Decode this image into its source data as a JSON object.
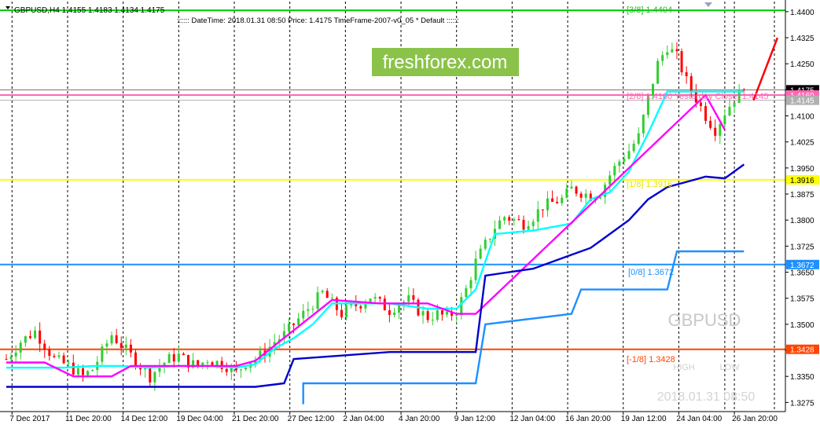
{
  "header": {
    "symbol_info": "GBPUSD,H4  1.4155 1.4183 1.4134 1.4175",
    "info_line": ":::::: DateTime: 2018.01.31 08:50    Price: 1.4175    TimeFrame-2007-v0_05    *    Default    ::::::"
  },
  "watermark": {
    "brand": "freshforex.com",
    "symbol": "GBPUSD",
    "datetime": "2018.01.31 08:50",
    "high_label": "HIGH",
    "low_label": "LOW"
  },
  "murrey_labels": [
    {
      "id": "p3",
      "text": "[3/8]  1.4404"
    },
    {
      "id": "p2",
      "text": "[2/8]  1.4160  Yesterday Close: 1.4145"
    },
    {
      "id": "p1",
      "text": "[1/8]  1.3916"
    },
    {
      "id": "p0",
      "text": "[0/8]  1.3672"
    },
    {
      "id": "m1",
      "text": "[-1/8]  1.3428"
    }
  ],
  "price_axis": {
    "ticks": [
      "1.4400",
      "1.4325",
      "1.4250",
      "1.4175",
      "1.4100",
      "1.4025",
      "1.3950",
      "1.3875",
      "1.3800",
      "1.3725",
      "1.3650",
      "1.3575",
      "1.3500",
      "1.3425",
      "1.3350",
      "1.3275"
    ],
    "tags": [
      {
        "id": "last",
        "text": "1.4175",
        "value": 1.4175,
        "color": "#000000",
        "text_color": "#ffffff"
      },
      {
        "id": "l2",
        "text": "1.4160",
        "value": 1.416,
        "color": "#ff69b4",
        "text_color": "#ffffff"
      },
      {
        "id": "yc",
        "text": "1.4145",
        "value": 1.4145,
        "color": "#b0b0b0",
        "text_color": "#ffffff"
      },
      {
        "id": "l1",
        "text": "1.3916",
        "value": 1.3916,
        "color": "#ffff00",
        "text_color": "#000000"
      },
      {
        "id": "l0",
        "text": "1.3672",
        "value": 1.3672,
        "color": "#1e90ff",
        "text_color": "#ffffff"
      },
      {
        "id": "lm1",
        "text": "1.3428",
        "value": 1.3428,
        "color": "#ff4500",
        "text_color": "#ffffff"
      }
    ]
  },
  "time_axis": {
    "labels": [
      "7 Dec 2017",
      "11 Dec 20:00",
      "14 Dec 12:00",
      "19 Dec 04:00",
      "21 Dec 20:00",
      "27 Dec 12:00",
      "2 Jan 04:00",
      "4 Jan 20:00",
      "9 Jan 12:00",
      "12 Jan 04:00",
      "16 Jan 20:00",
      "19 Jan 12:00",
      "24 Jan 04:00",
      "26 Jan 20:00"
    ]
  },
  "chart_data": {
    "type": "candlestick",
    "symbol": "GBPUSD",
    "timeframe": "H4",
    "ylim": [
      1.326,
      1.442
    ],
    "grid": true,
    "ohlc_current": {
      "open": 1.4155,
      "high": 1.4183,
      "low": 1.4134,
      "close": 1.4175
    },
    "horizontal_levels": [
      {
        "name": "[3/8]",
        "value": 1.4404,
        "color": "#00cc00"
      },
      {
        "name": "[2/8]",
        "value": 1.416,
        "color": "#ff69b4"
      },
      {
        "name": "Yesterday Close",
        "value": 1.4145,
        "color": "#b0b0b0"
      },
      {
        "name": "[1/8]",
        "value": 1.3916,
        "color": "#ffff00"
      },
      {
        "name": "[0/8]",
        "value": 1.3672,
        "color": "#1e90ff"
      },
      {
        "name": "[-1/8]",
        "value": 1.3428,
        "color": "#ff4500"
      }
    ],
    "close_path": [
      [
        0,
        1.34
      ],
      [
        3,
        1.345
      ],
      [
        6,
        1.348
      ],
      [
        8,
        1.344
      ],
      [
        10,
        1.34
      ],
      [
        13,
        1.338
      ],
      [
        16,
        1.335
      ],
      [
        18,
        1.337
      ],
      [
        20,
        1.342
      ],
      [
        22,
        1.347
      ],
      [
        24,
        1.344
      ],
      [
        26,
        1.341
      ],
      [
        28,
        1.338
      ],
      [
        30,
        1.335
      ],
      [
        32,
        1.338
      ],
      [
        34,
        1.34
      ],
      [
        36,
        1.341
      ],
      [
        38,
        1.339
      ],
      [
        40,
        1.338
      ],
      [
        42,
        1.34
      ],
      [
        44,
        1.339
      ],
      [
        46,
        1.338
      ],
      [
        48,
        1.336
      ],
      [
        50,
        1.339
      ],
      [
        52,
        1.34
      ],
      [
        54,
        1.342
      ],
      [
        56,
        1.345
      ],
      [
        58,
        1.347
      ],
      [
        60,
        1.35
      ],
      [
        62,
        1.353
      ],
      [
        64,
        1.356
      ],
      [
        66,
        1.359
      ],
      [
        68,
        1.356
      ],
      [
        70,
        1.353
      ],
      [
        72,
        1.355
      ],
      [
        74,
        1.356
      ],
      [
        76,
        1.358
      ],
      [
        78,
        1.356
      ],
      [
        80,
        1.354
      ],
      [
        82,
        1.356
      ],
      [
        84,
        1.357
      ],
      [
        86,
        1.354
      ],
      [
        88,
        1.352
      ],
      [
        90,
        1.353
      ],
      [
        92,
        1.352
      ],
      [
        94,
        1.354
      ],
      [
        96,
        1.36
      ],
      [
        98,
        1.368
      ],
      [
        100,
        1.373
      ],
      [
        102,
        1.378
      ],
      [
        104,
        1.381
      ],
      [
        106,
        1.38
      ],
      [
        108,
        1.379
      ],
      [
        110,
        1.381
      ],
      [
        112,
        1.384
      ],
      [
        114,
        1.385
      ],
      [
        116,
        1.386
      ],
      [
        118,
        1.389
      ],
      [
        120,
        1.388
      ],
      [
        122,
        1.387
      ],
      [
        124,
        1.388
      ],
      [
        126,
        1.393
      ],
      [
        128,
        1.397
      ],
      [
        130,
        1.4
      ],
      [
        132,
        1.404
      ],
      [
        134,
        1.415
      ],
      [
        136,
        1.425
      ],
      [
        138,
        1.43
      ],
      [
        140,
        1.427
      ],
      [
        142,
        1.42
      ],
      [
        144,
        1.415
      ],
      [
        146,
        1.41
      ],
      [
        148,
        1.406
      ],
      [
        150,
        1.411
      ],
      [
        152,
        1.415
      ],
      [
        154,
        1.4175
      ]
    ],
    "series": [
      {
        "name": "cyan",
        "color": "#00ffff",
        "width": 2.4,
        "points": [
          [
            0,
            1.3375
          ],
          [
            6,
            1.3375
          ],
          [
            12,
            1.3375
          ],
          [
            18,
            1.338
          ],
          [
            24,
            1.338
          ],
          [
            30,
            1.3375
          ],
          [
            36,
            1.338
          ],
          [
            42,
            1.338
          ],
          [
            48,
            1.3375
          ],
          [
            52,
            1.3385
          ],
          [
            56,
            1.343
          ],
          [
            60,
            1.346
          ],
          [
            64,
            1.35
          ],
          [
            68,
            1.356
          ],
          [
            72,
            1.356
          ],
          [
            80,
            1.356
          ],
          [
            88,
            1.3545
          ],
          [
            94,
            1.3545
          ],
          [
            98,
            1.36
          ],
          [
            102,
            1.376
          ],
          [
            110,
            1.377
          ],
          [
            118,
            1.379
          ],
          [
            122,
            1.386
          ],
          [
            126,
            1.388
          ],
          [
            130,
            1.394
          ],
          [
            134,
            1.405
          ],
          [
            138,
            1.417
          ],
          [
            150,
            1.417
          ],
          [
            154,
            1.417
          ]
        ]
      },
      {
        "name": "magenta",
        "color": "#ff00ff",
        "width": 2.4,
        "points": [
          [
            0,
            1.339
          ],
          [
            8,
            1.339
          ],
          [
            14,
            1.335
          ],
          [
            18,
            1.335
          ],
          [
            22,
            1.335
          ],
          [
            26,
            1.338
          ],
          [
            36,
            1.338
          ],
          [
            44,
            1.338
          ],
          [
            48,
            1.338
          ],
          [
            52,
            1.3395
          ],
          [
            68,
            1.357
          ],
          [
            78,
            1.356
          ],
          [
            88,
            1.356
          ],
          [
            94,
            1.353
          ],
          [
            98,
            1.353
          ],
          [
            146,
            1.416
          ],
          [
            150,
            1.406
          ]
        ]
      },
      {
        "name": "darkblue",
        "color": "#0000cd",
        "width": 2.4,
        "points": [
          [
            0,
            1.332
          ],
          [
            26,
            1.332
          ],
          [
            52,
            1.332
          ],
          [
            58,
            1.333
          ],
          [
            60,
            1.34
          ],
          [
            70,
            1.341
          ],
          [
            80,
            1.342
          ],
          [
            98,
            1.342
          ],
          [
            100,
            1.364
          ],
          [
            110,
            1.366
          ],
          [
            118,
            1.37
          ],
          [
            122,
            1.372
          ],
          [
            126,
            1.376
          ],
          [
            130,
            1.38
          ],
          [
            134,
            1.386
          ],
          [
            138,
            1.3895
          ],
          [
            146,
            1.3925
          ],
          [
            150,
            1.392
          ],
          [
            154,
            1.396
          ]
        ]
      },
      {
        "name": "lightblue",
        "color": "#1e90ff",
        "width": 2.4,
        "points": [
          [
            62,
            1.327
          ],
          [
            62,
            1.333
          ],
          [
            98,
            1.333
          ],
          [
            100,
            1.35
          ],
          [
            118,
            1.353
          ],
          [
            120,
            1.36
          ],
          [
            138,
            1.36
          ],
          [
            140,
            1.371
          ],
          [
            154,
            1.371
          ]
        ]
      }
    ],
    "projection": {
      "color": "#ff0000",
      "from": [
        156,
        1.4145
      ],
      "to": [
        161,
        1.4325
      ]
    }
  }
}
